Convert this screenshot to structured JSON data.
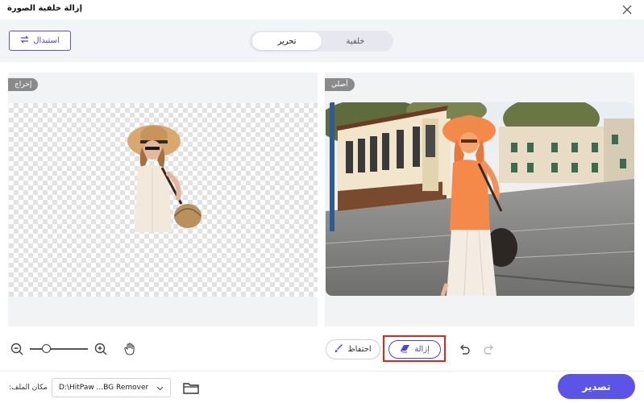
{
  "window": {
    "title": "إزالة خلفية الصورة"
  },
  "topbar": {
    "replace_label": "استبدال",
    "tabs": [
      {
        "label": "خلفية",
        "active": false
      },
      {
        "label": "تحرير",
        "active": true
      }
    ]
  },
  "panels": {
    "output_badge": "إخراج",
    "original_badge": "أصلي"
  },
  "tools": {
    "zoom_level": 0.25,
    "keep_label": "احتفاظ",
    "remove_label": "إزالة"
  },
  "footer": {
    "location_label": "مكان الملف:",
    "path_value": "D:\\HitPaw ...BG Remover",
    "export_label": "تصدير"
  },
  "colors": {
    "accent": "#5b54e6",
    "highlight": "#e0261f",
    "mask": "#f5894a"
  },
  "icons": [
    "close-icon",
    "swap-icon",
    "zoom-out-icon",
    "zoom-in-icon",
    "hand-icon",
    "brush-icon",
    "eraser-icon",
    "undo-icon",
    "redo-icon",
    "chevron-down-icon",
    "folder-icon"
  ]
}
